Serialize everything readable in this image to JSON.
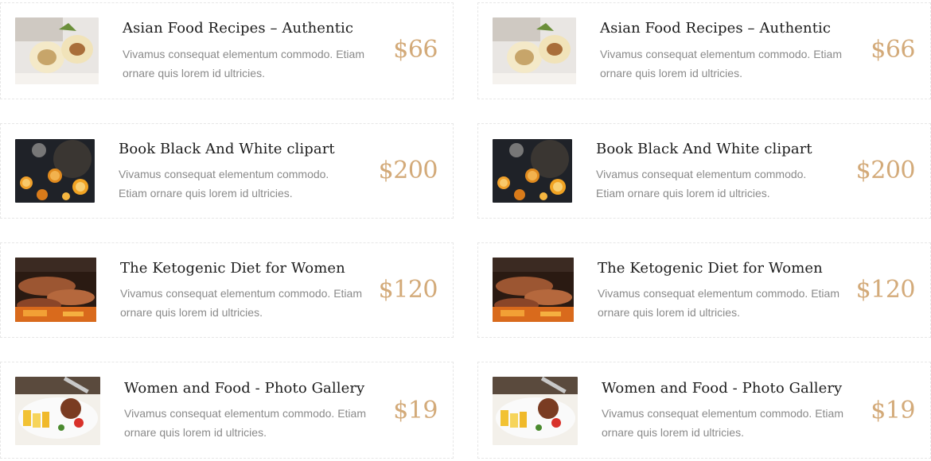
{
  "menu_items": [
    {
      "title": "Asian Food Recipes – Authentic",
      "description": "Vivamus consequat elementum commodo. Etiam ornare quis lorem id ultricies.",
      "price": "$66",
      "image": "sushi-rolls"
    },
    {
      "title": "Book Black And White clipart",
      "description": "Vivamus consequat elementum commodo. Etiam ornare quis lorem id ultricies.",
      "price": "$200",
      "image": "orange-slices-spices"
    },
    {
      "title": "The Ketogenic Diet for Women",
      "description": "Vivamus consequat elementum commodo. Etiam ornare quis lorem id ultricies.",
      "price": "$120",
      "image": "grilled-meat"
    },
    {
      "title": "Women and Food - Photo Gallery",
      "description": "Vivamus consequat elementum commodo. Etiam ornare quis lorem id ultricies.",
      "price": "$19",
      "image": "plated-dish"
    }
  ],
  "colors": {
    "price": "#d3aa79",
    "title": "#1c1c1c",
    "description": "#8a8a8a",
    "border": "#e6e6e6"
  }
}
